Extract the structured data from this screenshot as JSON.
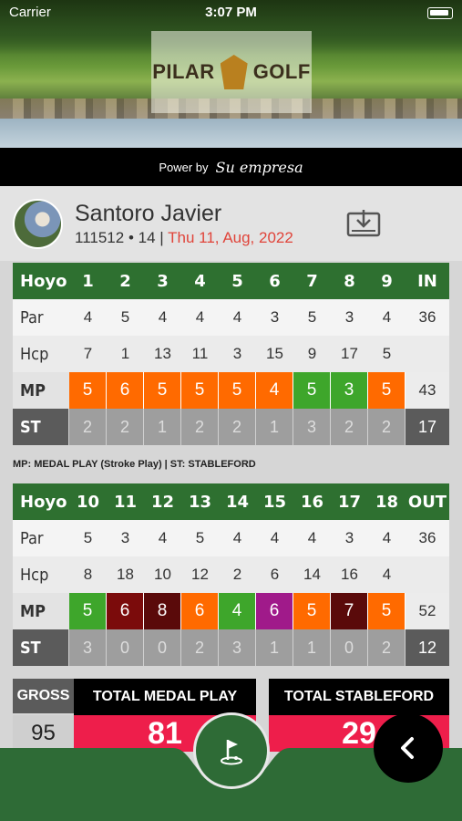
{
  "status": {
    "time": "3:07 PM",
    "carrier": "Carrier"
  },
  "banner": {
    "logo_left": "PILAR",
    "logo_right": "GOLF"
  },
  "power": {
    "label": "Power by",
    "brand": "Su empresa"
  },
  "player": {
    "name": "Santoro Javier",
    "id": "111512",
    "sep": "•",
    "handicap": "14",
    "bar": "|",
    "date": "Thu 11, Aug, 2022"
  },
  "colors": {
    "green": "#2e7030",
    "orange": "#ff6a00",
    "lightgreen": "#3ea62b",
    "darkred": "#7b0b0b",
    "maroon": "#5a0a0a",
    "purple": "#a01a8a",
    "red": "#ee1e4b"
  },
  "front": {
    "head": [
      "Hoyo",
      "1",
      "2",
      "3",
      "4",
      "5",
      "6",
      "7",
      "8",
      "9",
      "IN"
    ],
    "par": [
      "Par",
      "4",
      "5",
      "4",
      "4",
      "4",
      "3",
      "5",
      "3",
      "4",
      "36"
    ],
    "hcp": [
      "Hcp",
      "7",
      "1",
      "13",
      "11",
      "3",
      "15",
      "9",
      "17",
      "5",
      ""
    ],
    "mp": [
      "MP",
      "5",
      "6",
      "5",
      "5",
      "5",
      "4",
      "5",
      "3",
      "5",
      "43"
    ],
    "mp_colors": [
      "orange",
      "orange",
      "orange",
      "orange",
      "orange",
      "orange",
      "lightgreen",
      "lightgreen",
      "orange"
    ],
    "st": [
      "ST",
      "2",
      "2",
      "1",
      "2",
      "2",
      "1",
      "3",
      "2",
      "2",
      "17"
    ]
  },
  "note": "MP: MEDAL PLAY (Stroke Play) | ST: STABLEFORD",
  "back": {
    "head": [
      "Hoyo",
      "10",
      "11",
      "12",
      "13",
      "14",
      "15",
      "16",
      "17",
      "18",
      "OUT"
    ],
    "par": [
      "Par",
      "5",
      "3",
      "4",
      "5",
      "4",
      "4",
      "4",
      "3",
      "4",
      "36"
    ],
    "hcp": [
      "Hcp",
      "8",
      "18",
      "10",
      "12",
      "2",
      "6",
      "14",
      "16",
      "4",
      ""
    ],
    "mp": [
      "MP",
      "5",
      "6",
      "8",
      "6",
      "4",
      "6",
      "5",
      "7",
      "5",
      "52"
    ],
    "mp_colors": [
      "lightgreen",
      "darkred",
      "maroon",
      "orange",
      "lightgreen",
      "purple",
      "orange",
      "maroon",
      "orange"
    ],
    "st": [
      "ST",
      "3",
      "0",
      "0",
      "2",
      "3",
      "1",
      "1",
      "0",
      "2",
      "12"
    ]
  },
  "totals": {
    "gross_label": "GROSS",
    "gross_value": "95",
    "medal_label": "TOTAL MEDAL PLAY",
    "medal_value": "81",
    "stableford_label": "TOTAL STABLEFORD",
    "stableford_value": "29"
  },
  "icons": {
    "download": "download-icon",
    "golf": "golf-flag-icon",
    "back": "chevron-left-icon"
  }
}
